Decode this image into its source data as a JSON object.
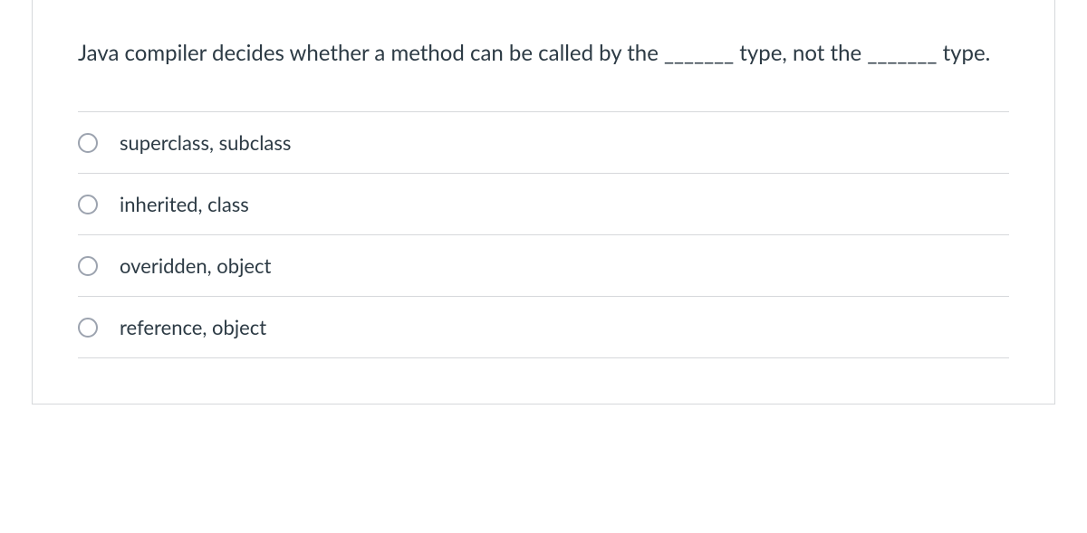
{
  "question": {
    "text": "Java compiler decides whether a method can be called by the _______ type, not the _______ type.",
    "options": [
      {
        "label": "superclass, subclass"
      },
      {
        "label": "inherited, class"
      },
      {
        "label": "overidden, object"
      },
      {
        "label": "reference, object"
      }
    ]
  }
}
